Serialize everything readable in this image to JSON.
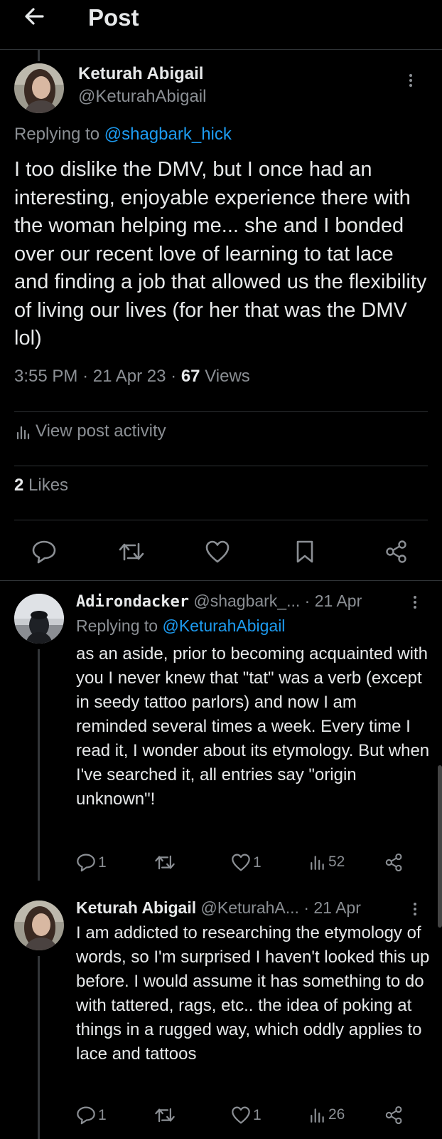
{
  "header": {
    "title": "Post"
  },
  "main_post": {
    "author_name": "Keturah Abigail",
    "author_handle": "@KeturahAbigail",
    "replying_prefix": "Replying to",
    "replying_to": "@shagbark_hick",
    "text": "I too dislike the DMV, but I once had an interesting, enjoyable experience there with the woman helping me... she and I bonded over our recent love of learning to tat lace and finding a job that allowed us the flexibility of living our lives (for her that was the DMV lol)",
    "time": "3:55 PM",
    "date": "21 Apr 23",
    "views_count": "67",
    "views_label": "Views",
    "activity_label": "View post activity",
    "likes_count": "2",
    "likes_label": "Likes"
  },
  "replies": [
    {
      "author_name": "Adirondacker",
      "author_handle": "@shagbark_...",
      "date": "21 Apr",
      "replying_prefix": "Replying to",
      "replying_to": "@KeturahAbigail",
      "text": "as an aside, prior to becoming acquainted with you I never knew that \"tat\" was a verb (except in seedy tattoo parlors) and now I am reminded several times a week. Every time I read it, I wonder about its etymology. But when I've searched it, all entries say \"origin unknown\"!",
      "replies_count": "1",
      "likes_count": "1",
      "views_count": "52"
    },
    {
      "author_name": "Keturah Abigail",
      "author_handle": "@KeturahA...",
      "date": "21 Apr",
      "text": "I am addicted to researching the etymology of words, so I'm surprised I haven't looked this up before. I would assume it has something to do with tattered, rags, etc.. the idea of poking at things in a rugged way, which oddly applies to lace and tattoos",
      "replies_count": "1",
      "likes_count": "1",
      "views_count": "26"
    }
  ],
  "separator": "·",
  "colors": {
    "background": "#000000",
    "text": "#e7e9ea",
    "muted": "#8b8f94",
    "link": "#1d9bf0",
    "divider": "#2f3336"
  },
  "icons": [
    "back-arrow-icon",
    "more-icon",
    "stats-icon",
    "reply-icon",
    "retweet-icon",
    "like-icon",
    "bookmark-icon",
    "share-icon"
  ]
}
